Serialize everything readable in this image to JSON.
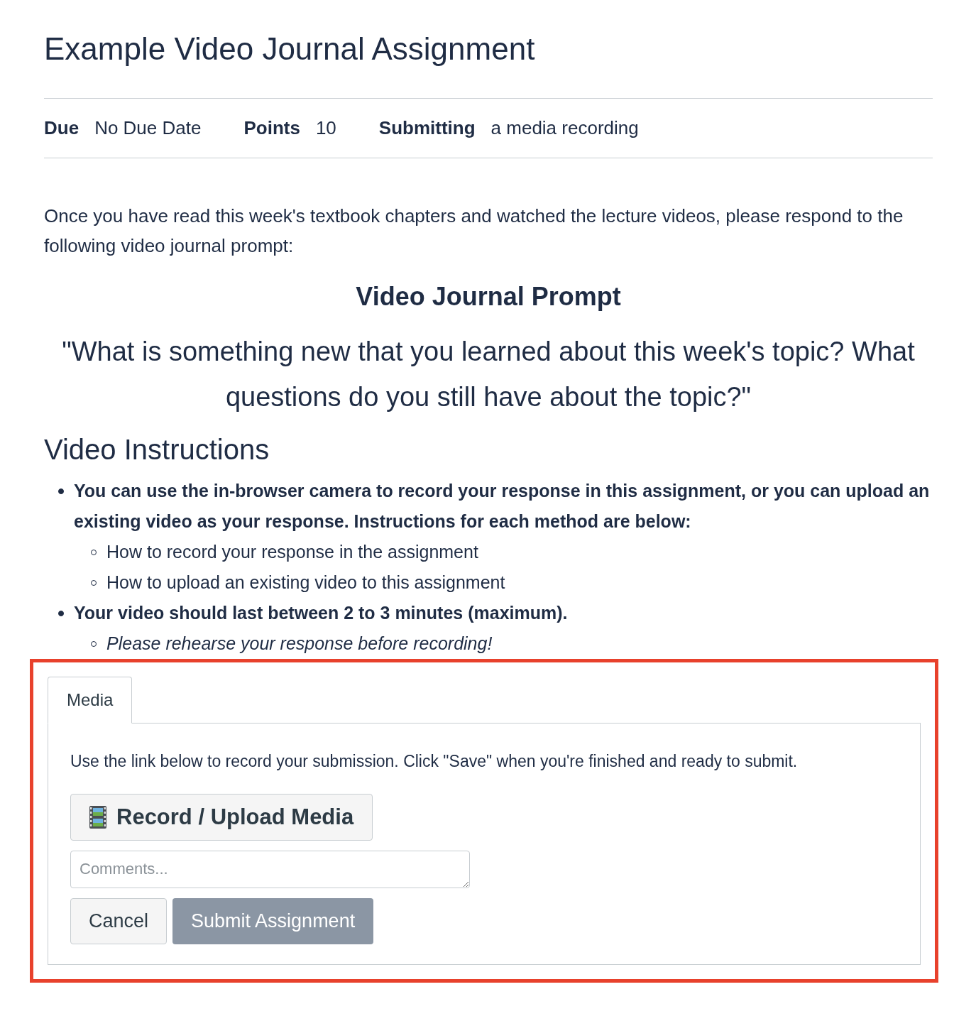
{
  "title": "Example Video Journal Assignment",
  "details": [
    {
      "label": "Due",
      "value": "No Due Date"
    },
    {
      "label": "Points",
      "value": "10"
    },
    {
      "label": "Submitting",
      "value": "a media recording"
    }
  ],
  "intro": "Once you have read this week's textbook chapters and watched the lecture videos, please respond to the following video journal prompt:",
  "prompt_heading": "Video Journal Prompt",
  "prompt_quote": "\"What is something new that you learned about this week's topic? What questions do you still have about the topic?\"",
  "instructions_heading": "Video Instructions",
  "instructions": [
    {
      "text": "You can use the in-browser camera to record your response in this assignment, or you can upload an existing video as your response. Instructions for each method are below:",
      "kind": "bold",
      "children": [
        {
          "text": "How to record your response in the assignment",
          "kind": "plain"
        },
        {
          "text": "How to upload an existing video to this assignment",
          "kind": "plain"
        }
      ]
    },
    {
      "text": "Your video should last between 2 to 3 minutes (maximum).",
      "kind": "bold",
      "children": [
        {
          "text": "Please rehearse your response before recording!",
          "kind": "italic"
        }
      ]
    }
  ],
  "submission": {
    "highlighted": true,
    "tabs": [
      {
        "label": "Media",
        "selected": true
      }
    ],
    "help_text": "Use the link below to record your submission. Click \"Save\" when you're finished and ready to submit.",
    "record_button": "Record / Upload Media",
    "comments": {
      "placeholder": "Comments..."
    },
    "cancel_button": "Cancel",
    "submit_button": {
      "label": "Submit Assignment",
      "disabled": true
    }
  }
}
